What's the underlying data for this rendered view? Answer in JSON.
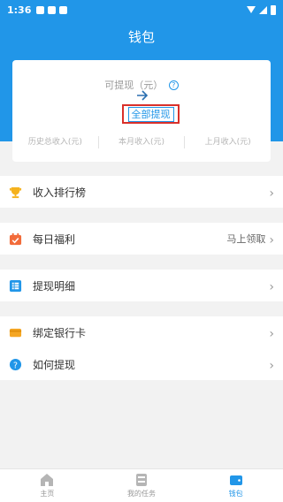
{
  "status_bar": {
    "time": "1:36"
  },
  "header": {
    "title": "钱包"
  },
  "balance_card": {
    "label": "可提现（元）",
    "help_icon": "question-circle-icon",
    "value": "",
    "withdraw_all_button": "全部提现",
    "stats": [
      {
        "label": "历史总收入(元)"
      },
      {
        "label": "本月收入(元)"
      },
      {
        "label": "上月收入(元)"
      }
    ]
  },
  "menu": [
    {
      "label": "收入排行榜",
      "icon": "trophy-icon",
      "extra": ""
    },
    {
      "label": "每日福利",
      "icon": "calendar-icon",
      "extra": "马上领取"
    },
    {
      "label": "提现明细",
      "icon": "list-icon",
      "extra": ""
    },
    {
      "label": "绑定银行卡",
      "icon": "bank-card-icon",
      "extra": ""
    },
    {
      "label": "如何提现",
      "icon": "help-icon",
      "extra": ""
    }
  ],
  "tabbar": {
    "items": [
      {
        "label": "主页",
        "icon": "home-icon",
        "active": false
      },
      {
        "label": "我的任务",
        "icon": "task-icon",
        "active": false
      },
      {
        "label": "钱包",
        "icon": "wallet-icon",
        "active": true
      }
    ]
  },
  "colors": {
    "primary": "#2196e8",
    "highlight": "#d9302a",
    "background": "#f2f2f2"
  }
}
